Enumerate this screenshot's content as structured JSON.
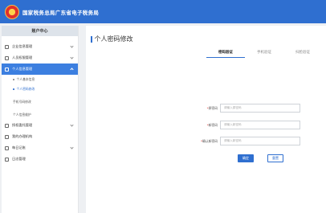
{
  "header": {
    "title": "国家税务总局广东省电子税务局"
  },
  "sidebar": {
    "heading": "账户中心",
    "items": [
      {
        "label": "企业信息管理"
      },
      {
        "label": "人员权限管理"
      },
      {
        "label": "个人信息管理"
      },
      {
        "label": "授权委托管理"
      },
      {
        "label": "我的办理机构"
      },
      {
        "label": "每日记账"
      },
      {
        "label": "日志管理"
      }
    ],
    "sub_items": [
      {
        "label": "个人基本信息"
      },
      {
        "label": "个人密码修改"
      },
      {
        "label": "手机号码修改"
      },
      {
        "label": "个人信息维护"
      }
    ]
  },
  "main": {
    "title": "个人密码修改",
    "tabs": [
      {
        "label": "密码验证"
      },
      {
        "label": "手机验证"
      },
      {
        "label": "扫脸验证"
      }
    ],
    "form": {
      "old_password": {
        "label": "原密码",
        "placeholder": "请输入原密码"
      },
      "new_password": {
        "label": "新密码",
        "placeholder": "请输入新密码"
      },
      "confirm_password": {
        "label": "确认新密码",
        "placeholder": "请输入新密码"
      }
    },
    "buttons": {
      "confirm": "确定",
      "reset": "重置"
    }
  },
  "colors": {
    "brand": "#2f6fd0",
    "active_menu": "#3c7fe0",
    "required": "#e0302c"
  }
}
